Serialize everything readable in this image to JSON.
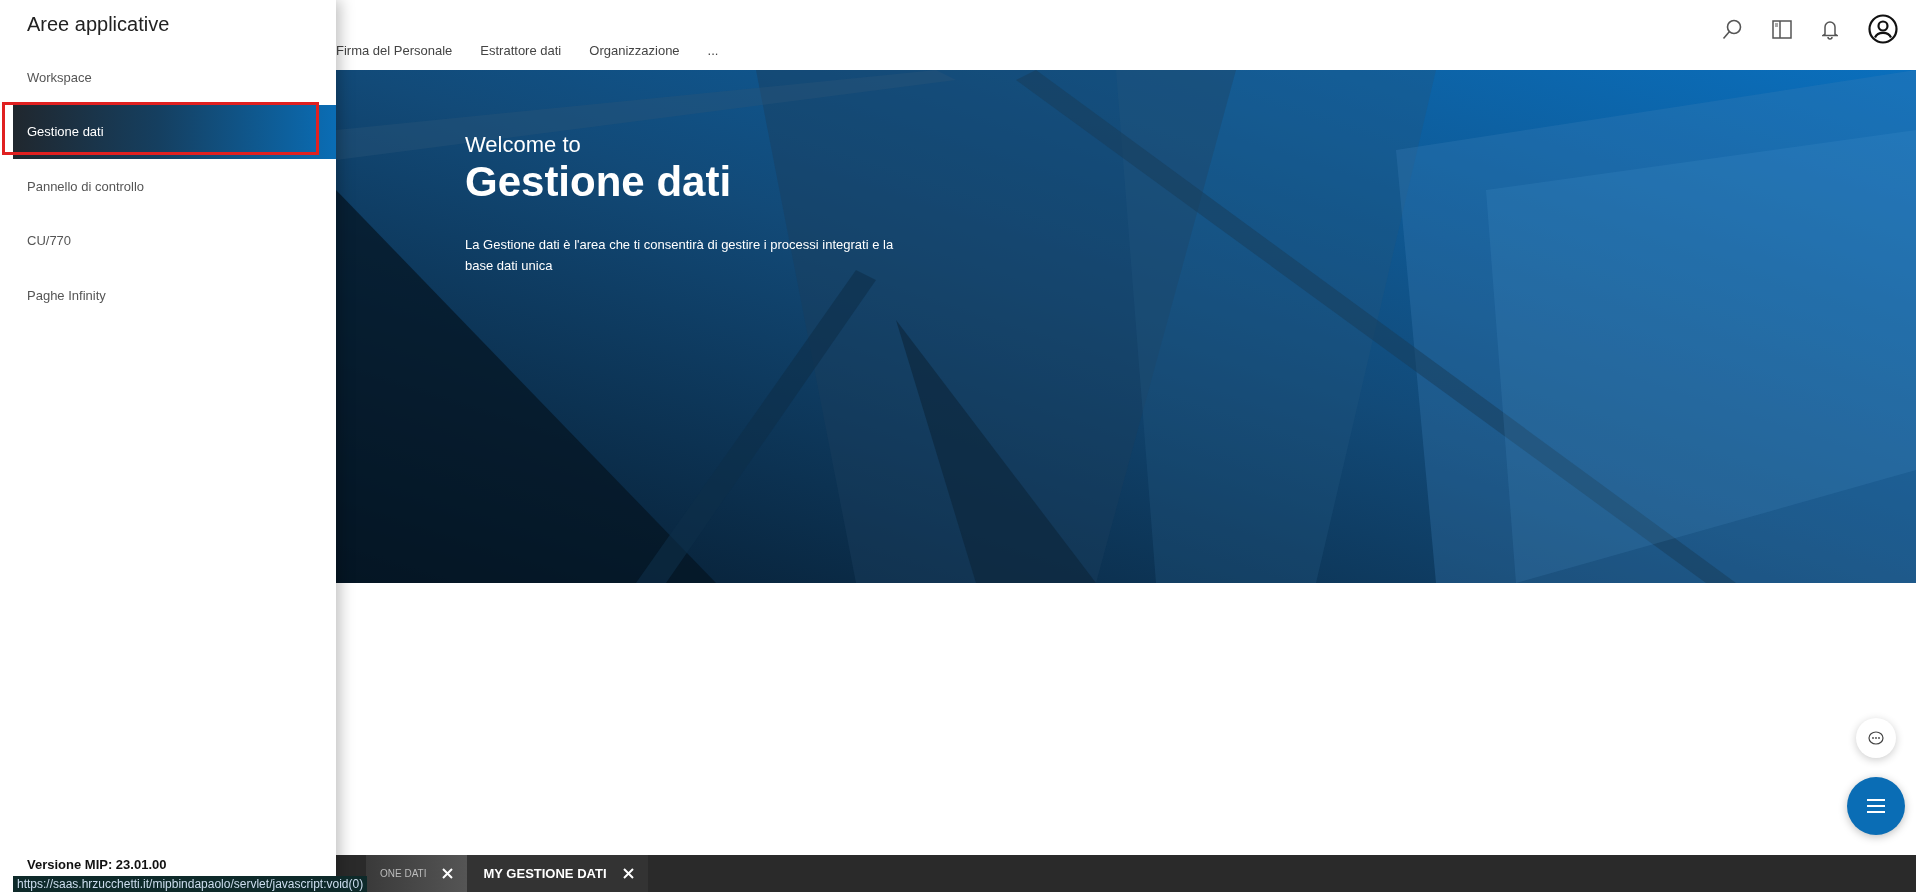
{
  "sidebar": {
    "title": "Aree applicative",
    "items": [
      {
        "label": "Workspace",
        "selected": false
      },
      {
        "label": "Gestione dati",
        "selected": true
      },
      {
        "label": "Pannello di controllo",
        "selected": false
      },
      {
        "label": "CU/770",
        "selected": false
      },
      {
        "label": "Paghe Infinity",
        "selected": false
      }
    ],
    "version": "Versione MIP: 23.01.00"
  },
  "nav": {
    "items": [
      "Firma del Personale",
      "Estrattore dati",
      "Organizzazione",
      "..."
    ]
  },
  "hero": {
    "greeting": "Welcome to",
    "title": "Gestione dati",
    "description": "La Gestione dati è l'area che ti consentirà di gestire i processi integrati e la base dati unica"
  },
  "tabs": [
    {
      "label": "ONE DATI",
      "selected": false
    },
    {
      "label": "MY GESTIONE DATI",
      "selected": true
    }
  ],
  "status_url": "https://saas.hrzucchetti.it/mipbindapaolo/servlet/javascript:void(0)"
}
